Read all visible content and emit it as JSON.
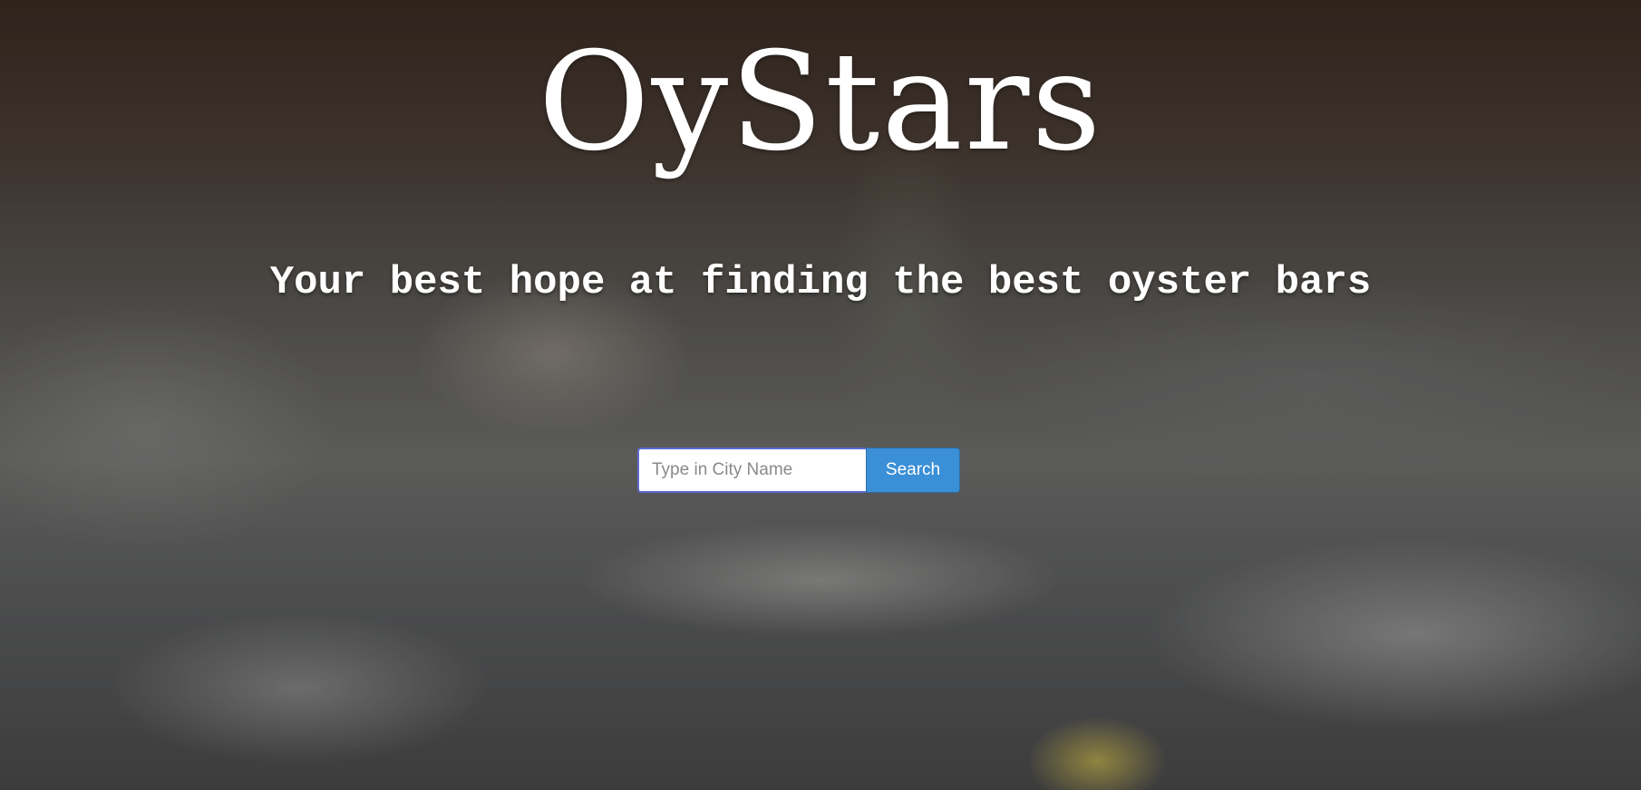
{
  "hero": {
    "logo_text": "OyStars",
    "tagline": "Your best hope at finding the best oyster bars"
  },
  "search": {
    "placeholder": "Type in City Name",
    "value": "",
    "button_label": "Search",
    "button_color": "#3a8fd6"
  }
}
